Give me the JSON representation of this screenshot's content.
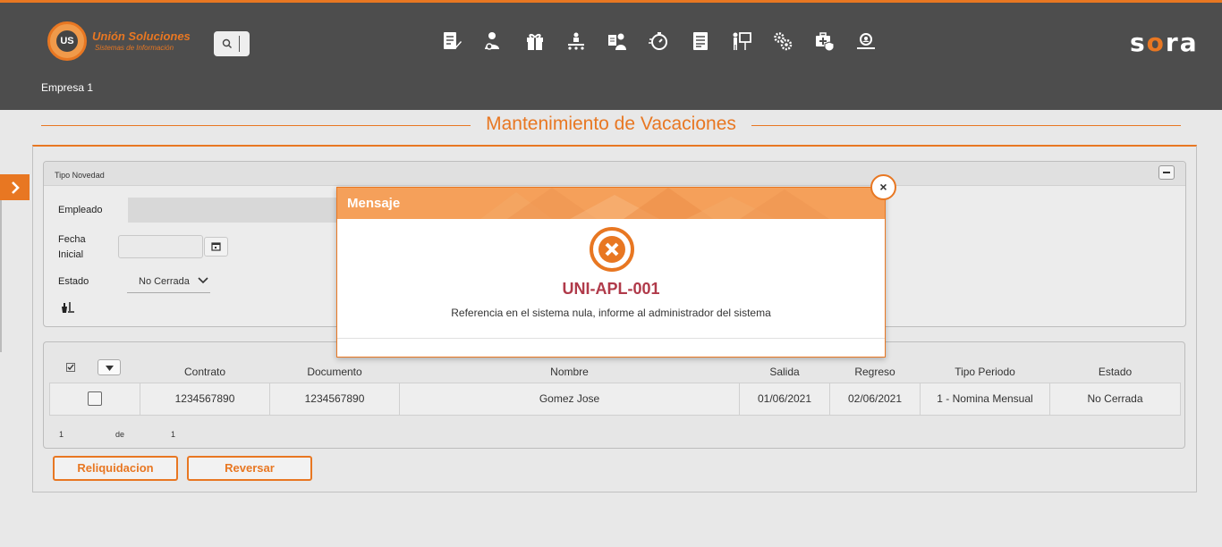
{
  "header": {
    "logo_name": "Unión Soluciones",
    "logo_sub": "Sistemas de Información",
    "logo_mark": "US",
    "brand_left": "s",
    "brand_dot": "o",
    "brand_right": "ra",
    "company": "Empresa 1",
    "nav_icons": [
      "document-edit-icon",
      "user-settings-icon",
      "gift-icon",
      "org-chart-icon",
      "employee-badge-icon",
      "timer-icon",
      "report-icon",
      "presentation-icon",
      "gears-icon",
      "medical-kit-icon",
      "search-person-icon"
    ]
  },
  "page": {
    "title": "Mantenimiento de Vacaciones"
  },
  "filter": {
    "panel_title": "Tipo Novedad",
    "empleado_label": "Empleado",
    "empleado_value": "",
    "fecha_label_1": "Fecha",
    "fecha_label_2": "Inicial",
    "fecha_value": "",
    "estado_label": "Estado",
    "estado_value": "No Cerrada"
  },
  "grid": {
    "columns": [
      "Contrato",
      "Documento",
      "Nombre",
      "Salida",
      "Regreso",
      "Tipo Periodo",
      "Estado"
    ],
    "rows": [
      {
        "contrato": "1234567890",
        "documento": "1234567890",
        "nombre": "Gomez Jose",
        "salida": "01/06/2021",
        "regreso": "02/06/2021",
        "tipo_periodo": "1 - Nomina Mensual",
        "estado": "No Cerrada"
      }
    ],
    "pager": {
      "current": "1",
      "of_label": "de",
      "total": "1"
    }
  },
  "actions": {
    "reliquidacion": "Reliquidacion",
    "reversar": "Reversar"
  },
  "modal": {
    "title": "Mensaje",
    "code": "UNI-APL-001",
    "message": "Referencia en el sistema nula, informe al administrador del sistema",
    "close": "×"
  },
  "colors": {
    "accent": "#e87722",
    "header_bg": "#4d4d4d",
    "error": "#b03a4a"
  }
}
